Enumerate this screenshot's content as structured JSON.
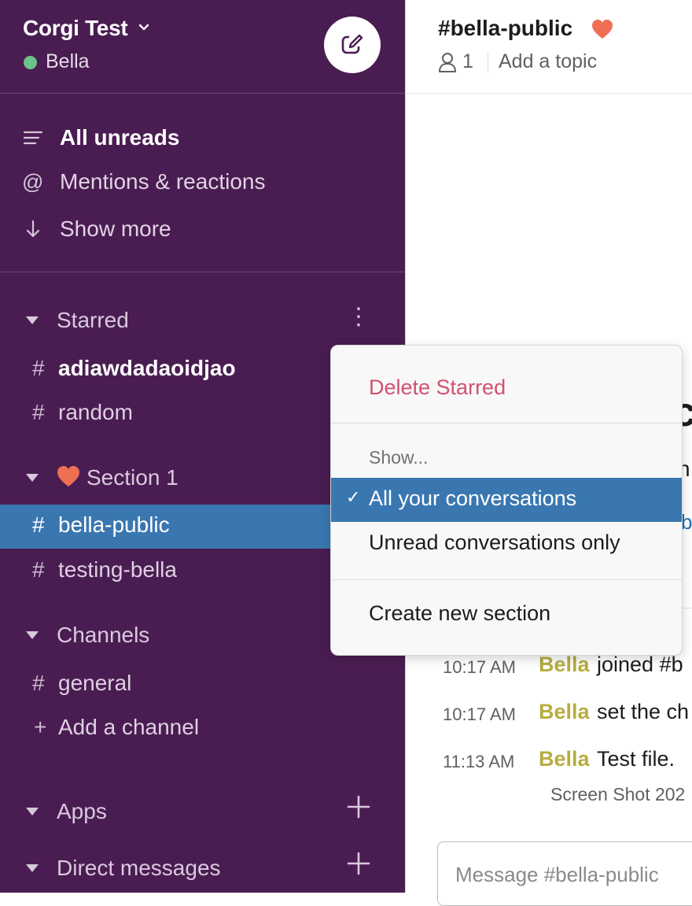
{
  "workspace": {
    "name": "Corgi Test",
    "user": "Bella"
  },
  "nav": {
    "all_unreads": "All unreads",
    "mentions": "Mentions & reactions",
    "show_more": "Show more"
  },
  "sections": {
    "starred": {
      "label": "Starred",
      "channels": [
        "adiawdadaoidjao",
        "random"
      ]
    },
    "section1": {
      "label": "Section 1",
      "channels": [
        "bella-public",
        "testing-bella"
      ]
    },
    "channels": {
      "label": "Channels",
      "channels": [
        "general"
      ],
      "add_label": "Add a channel"
    },
    "apps": {
      "label": "Apps"
    },
    "direct_messages": {
      "label": "Direct messages"
    }
  },
  "channel_header": {
    "title": "#bella-public",
    "member_count": "1",
    "add_topic": "Add a topic"
  },
  "menu": {
    "delete_label": "Delete Starred",
    "show_label": "Show...",
    "options": [
      "All your conversations",
      "Unread conversations only"
    ],
    "selected_option": "All your conversations",
    "create_section": "Create new section"
  },
  "partial_text": {
    "big_glyph": "c",
    "line_glyph": "n",
    "link_glyph": "b"
  },
  "messages": [
    {
      "time": "10:17 AM",
      "author": "Bella",
      "text": "joined #b"
    },
    {
      "time": "10:17 AM",
      "author": "Bella",
      "text": "set the ch"
    },
    {
      "time": "11:13 AM",
      "author": "Bella",
      "text": "Test file."
    }
  ],
  "file_name": "Screen Shot 202",
  "composer": {
    "placeholder": "Message #bella-public"
  },
  "colors": {
    "sidebar_bg": "#4a1d52",
    "active_item": "#3a77b0",
    "presence": "#6cc38a",
    "author": "#b7ad40",
    "danger": "#d4506f"
  }
}
